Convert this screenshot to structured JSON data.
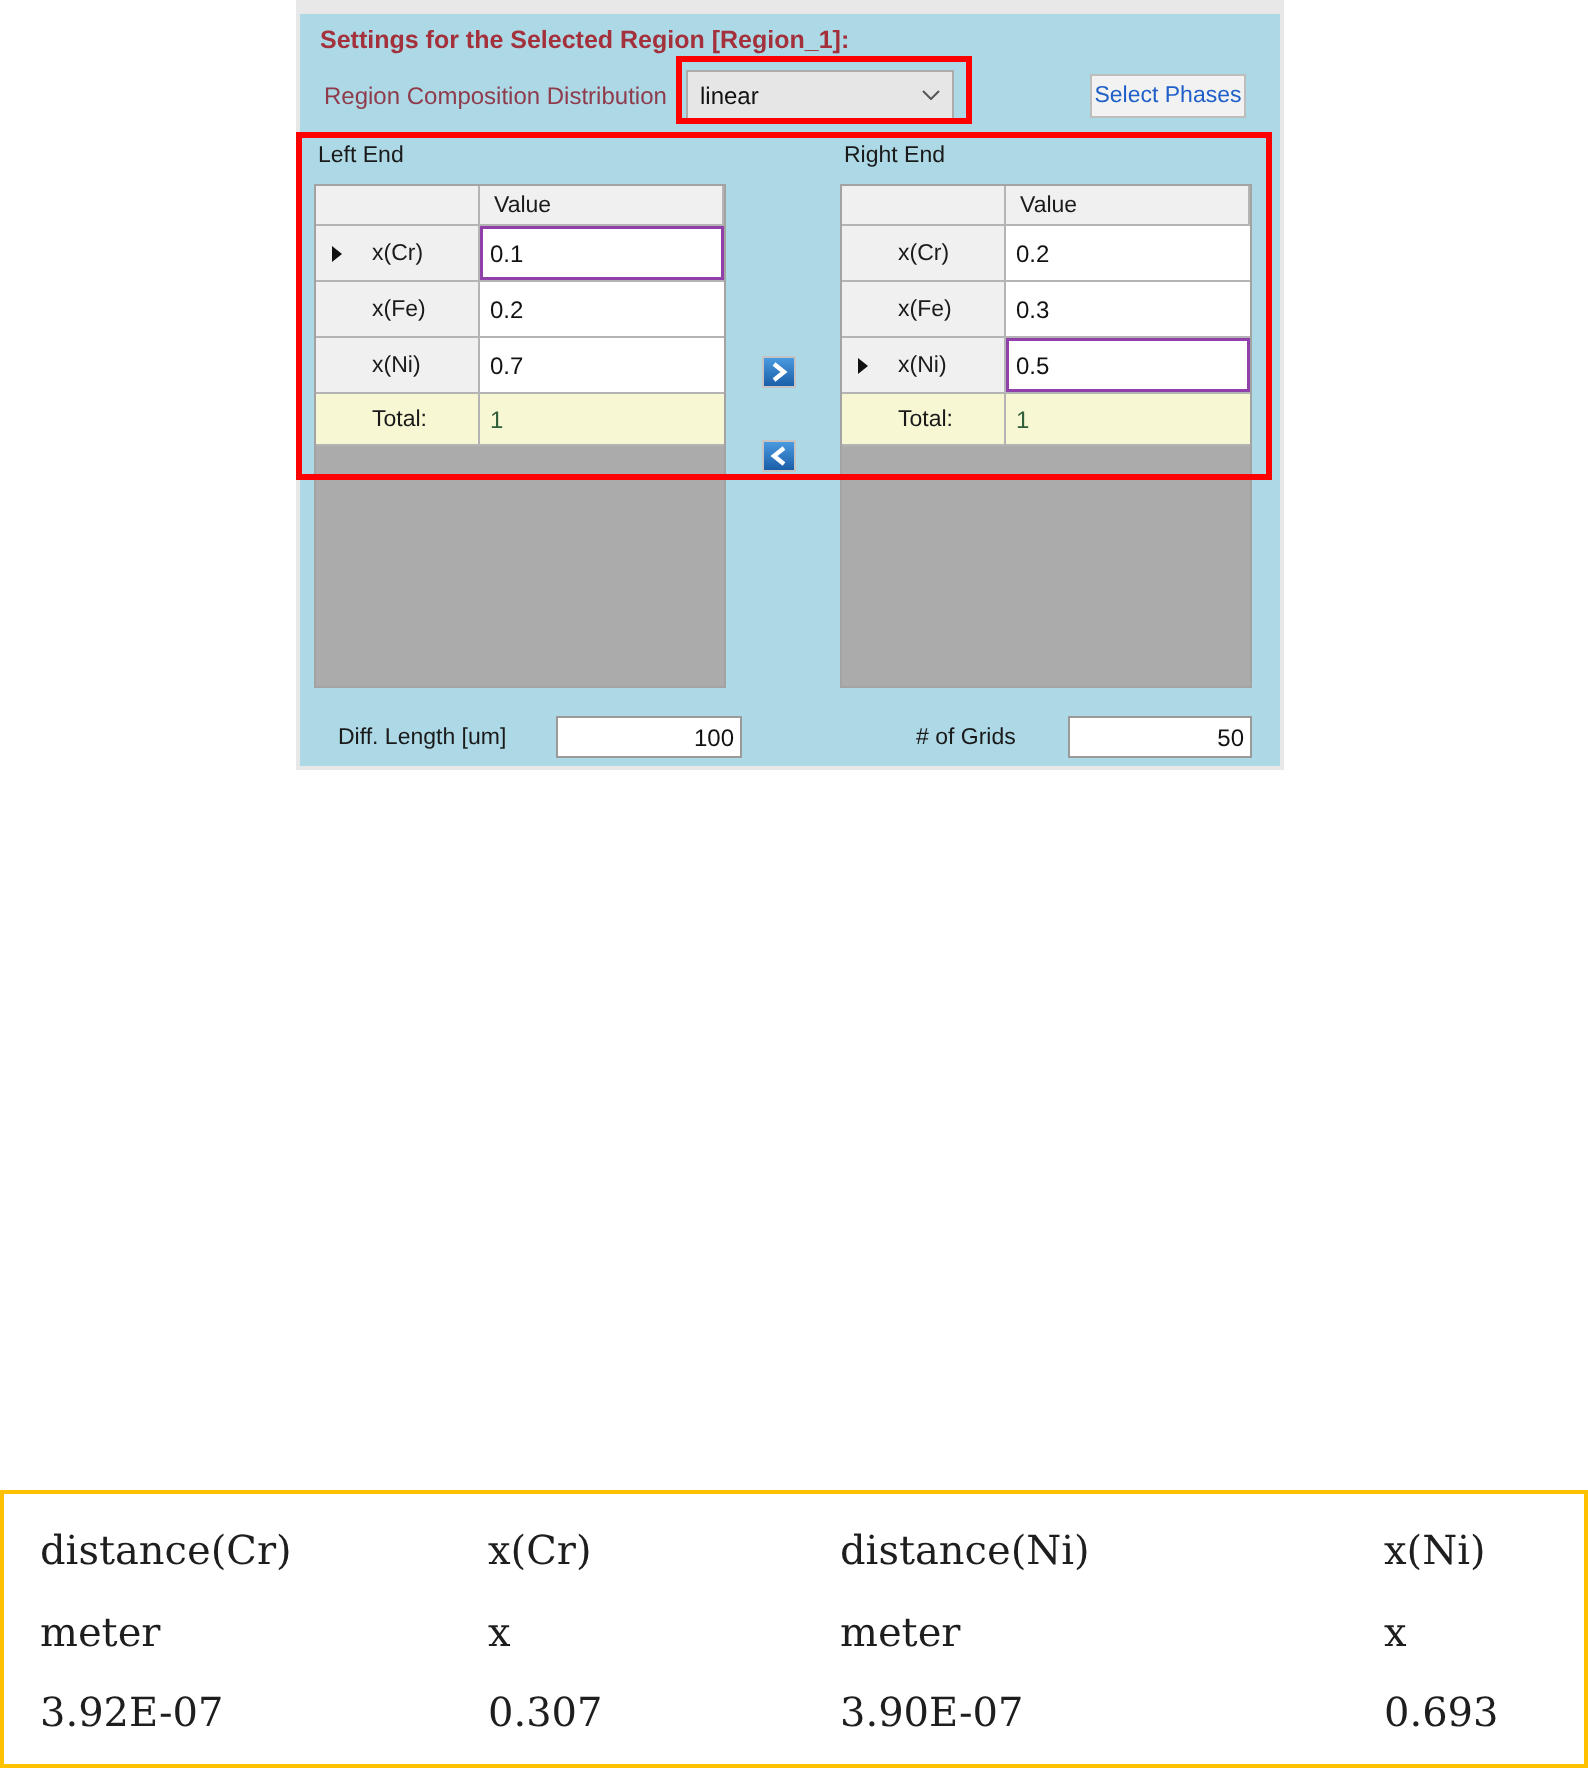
{
  "settings_panel": {
    "title": "Settings for the Selected Region [Region_1]:",
    "distribution": {
      "label": "Region Composition Distribution",
      "value": "linear",
      "highlighted": true
    },
    "select_phases_button": "Select Phases",
    "ends": {
      "highlighted": true,
      "panels": [
        {
          "title": "Left End",
          "column_header": "Value",
          "rows": [
            {
              "name": "x(Cr)",
              "value": "0.1",
              "selected": true
            },
            {
              "name": "x(Fe)",
              "value": "0.2",
              "selected": false
            },
            {
              "name": "x(Ni)",
              "value": "0.7",
              "selected": false
            }
          ],
          "total": {
            "label": "Total:",
            "value": "1"
          }
        },
        {
          "title": "Right End",
          "column_header": "Value",
          "rows": [
            {
              "name": "x(Cr)",
              "value": "0.2",
              "selected": false
            },
            {
              "name": "x(Fe)",
              "value": "0.3",
              "selected": false
            },
            {
              "name": "x(Ni)",
              "value": "0.5",
              "selected": true
            }
          ],
          "total": {
            "label": "Total:",
            "value": "1"
          }
        }
      ]
    },
    "diff_length": {
      "label": "Diff. Length [um]",
      "value": "100"
    },
    "grid_count": {
      "label": "# of Grids",
      "value": "50"
    }
  },
  "result_table": {
    "rows": [
      [
        "distance(Cr)",
        "x(Cr)",
        "distance(Ni)",
        "x(Ni)"
      ],
      [
        "meter",
        "x",
        "meter",
        "x"
      ],
      [
        "3.92E-07",
        "0.307",
        "3.90E-07",
        "0.693"
      ]
    ]
  }
}
